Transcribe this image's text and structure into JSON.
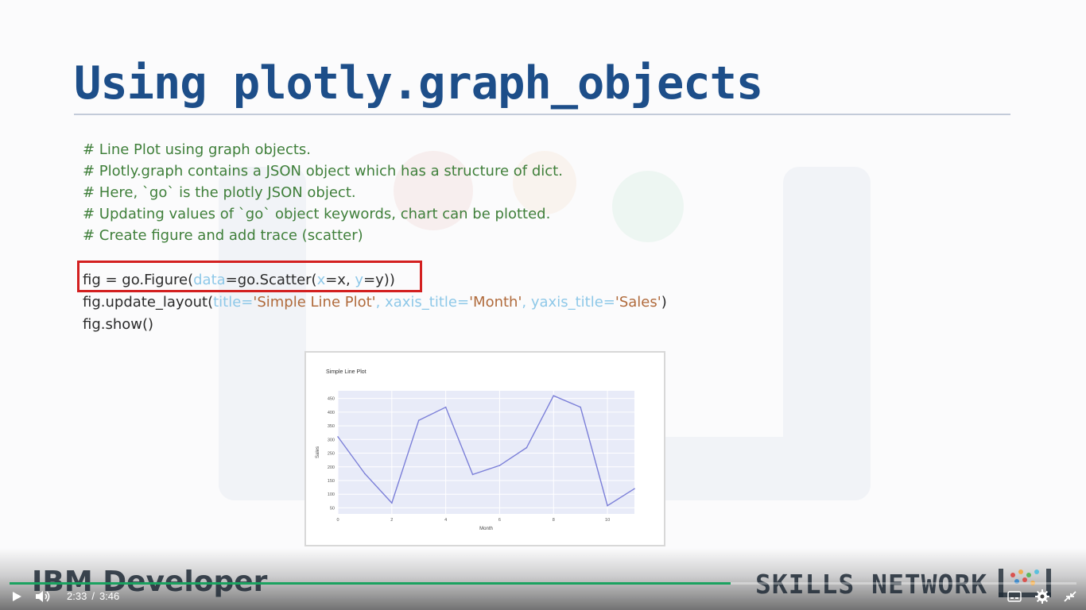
{
  "slide": {
    "title": "Using plotly.graph_objects",
    "comments": [
      "# Line Plot using graph objects.",
      "# Plotly.graph contains a JSON object which has a structure of dict.",
      "# Here, `go` is the plotly JSON object.",
      "# Updating values of `go` object keywords, chart can be plotted.",
      "# Create figure and add trace (scatter)"
    ],
    "code": {
      "line1": {
        "a": "fig = go.Figure(",
        "kw_data": "data",
        "b": "=go.Scatter(",
        "kw_x": "x",
        "c": "=x, ",
        "kw_y": "y",
        "d": "=y))"
      },
      "line2": {
        "a": "fig.update_layout(",
        "kw_title": "title",
        "eq1": "=",
        "str_title": "'Simple Line Plot'",
        "sep1": ", ",
        "kw_xaxis": "xaxis_title",
        "eq2": "=",
        "str_xaxis": "'Month'",
        "sep2": ", ",
        "kw_yaxis": "yaxis_title",
        "eq3": "=",
        "str_yaxis": "'Sales'",
        "end": ")"
      },
      "line3": "fig.show()"
    },
    "colors": {
      "title": "#1d4e89",
      "comment": "#3f7f3a",
      "keyword": "#8ec8e8",
      "string": "#b06a3b",
      "highlight_border": "#d32020"
    }
  },
  "chart_data": {
    "type": "line",
    "title": "Simple Line Plot",
    "xlabel": "Month",
    "ylabel": "Sales",
    "x": [
      0,
      1,
      2,
      3,
      4,
      5,
      6,
      7,
      8,
      9,
      10,
      11
    ],
    "y": [
      310,
      175,
      68,
      370,
      418,
      172,
      205,
      270,
      460,
      418,
      58,
      120
    ],
    "xlim": [
      0,
      11
    ],
    "ylim": [
      28,
      478
    ],
    "xticks": [
      "0",
      "2",
      "4",
      "6",
      "8",
      "10"
    ],
    "yticks": [
      "50",
      "100",
      "150",
      "200",
      "250",
      "300",
      "350",
      "400",
      "450"
    ],
    "line_color": "#7b7fd8",
    "plot_background": "#e8ebf8",
    "grid": true
  },
  "branding": {
    "left": "IBM Developer",
    "right": "SKILLS NETWORK"
  },
  "player": {
    "current_time": "2:33",
    "separator": "/",
    "duration": "3:46",
    "progress": 0.676,
    "accent_color": "#1aa260",
    "icons": [
      "play-icon",
      "volume-icon",
      "captions-icon",
      "settings-icon",
      "exit-fullscreen-icon"
    ]
  }
}
